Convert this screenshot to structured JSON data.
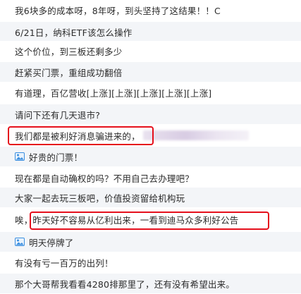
{
  "comments": [
    {
      "text": "我6块多的成本呀，8年呀，到头坚持了这结果！！C"
    },
    {
      "text": "6/21日，纳科ETF该怎么操作"
    },
    {
      "text": "这个价位，到三板还剩多少"
    },
    {
      "text": "赶紧买门票，重组成功翻倍"
    },
    {
      "text": "有道理，百亿营收[上涨][上涨][上涨][上涨][上涨]"
    },
    {
      "text": "请问下还有几天退市?"
    },
    {
      "text": "我们都是被利好消息骗进来的，"
    },
    {
      "text": "好贵的门票！",
      "icon": "image-icon"
    },
    {
      "text": "现在都是自动确权的吗？不用自己去办理吧？"
    },
    {
      "text": "大家一起去玩三板吧，价值投资留给机构玩"
    },
    {
      "text_prefix": "唉，",
      "text": "昨天好不容易从亿利出来，一看到迪马众多利好公告"
    },
    {
      "text": "明天停牌了",
      "icon": "image-icon"
    },
    {
      "text": "有没有亏一百万的出列！"
    },
    {
      "text": "那个大哥帮我看看4280排那里了，还有没有希望出来。"
    }
  ],
  "colors": {
    "highlight_box": "#e5101c",
    "alt_row": "#f3f5f8",
    "icon_blue": "#3b8fe0"
  }
}
